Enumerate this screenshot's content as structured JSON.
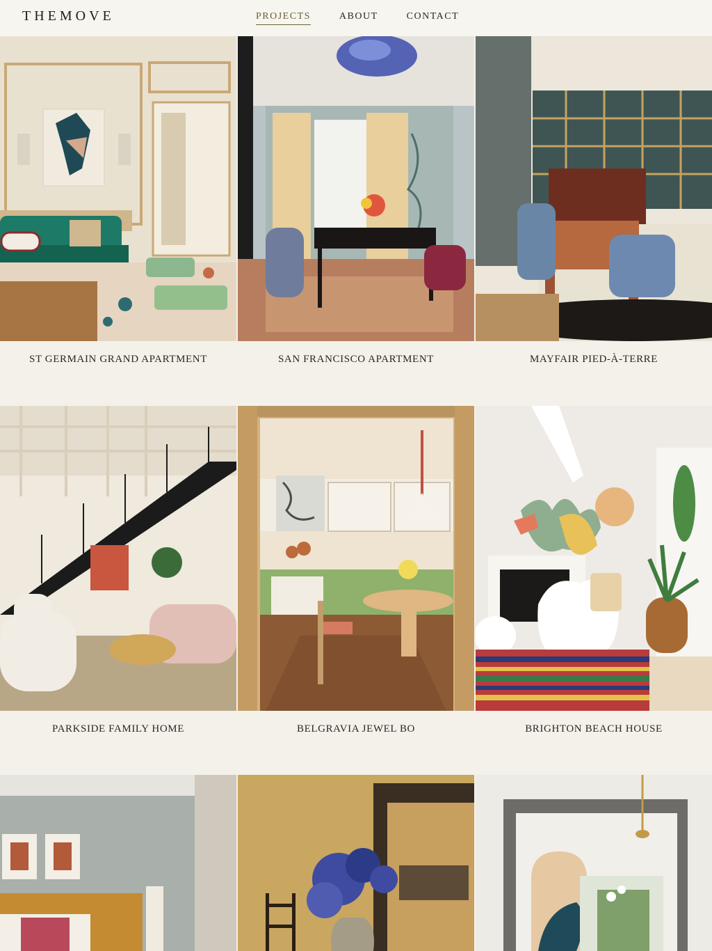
{
  "header": {
    "logo": "THEMOVE",
    "nav": [
      {
        "label": "PROJECTS",
        "active": true
      },
      {
        "label": "ABOUT",
        "active": false
      },
      {
        "label": "CONTACT",
        "active": false
      }
    ]
  },
  "projects": [
    {
      "title": "ST GERMAIN GRAND APARTMENT"
    },
    {
      "title": "SAN FRANCISCO APARTMENT"
    },
    {
      "title": "MAYFAIR PIED-À-TERRE"
    },
    {
      "title": "PARKSIDE FAMILY HOME"
    },
    {
      "title": "BELGRAVIA JEWEL BO"
    },
    {
      "title": "BRIGHTON BEACH HOUSE"
    },
    {
      "title": ""
    },
    {
      "title": ""
    },
    {
      "title": ""
    }
  ],
  "colors": {
    "background": "#f4f1eb",
    "accent": "#6a6031",
    "text": "#2a2620"
  }
}
